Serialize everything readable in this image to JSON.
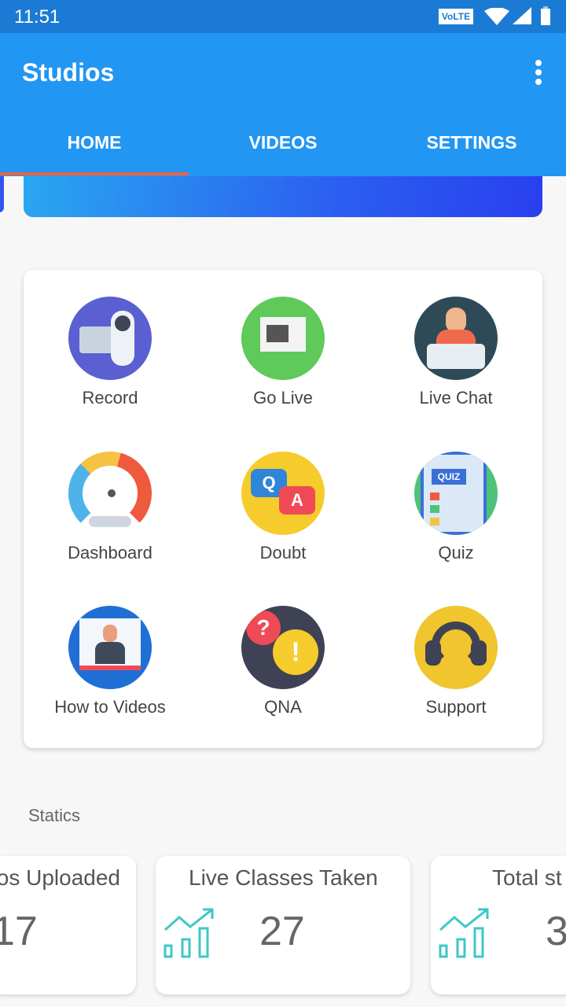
{
  "status": {
    "time": "11:51",
    "volte": "VoLTE"
  },
  "appbar": {
    "title": "Studios"
  },
  "tabs": [
    {
      "label": "HOME",
      "active": true
    },
    {
      "label": "VIDEOS"
    },
    {
      "label": "SETTINGS"
    }
  ],
  "colors": {
    "primary": "#2196f3",
    "status_bar": "#1b7bd4",
    "tab_indicator": "#e8634a",
    "trend_icon": "#3ec7c7"
  },
  "grid": [
    {
      "label": "Record",
      "icon": "video-camera-icon"
    },
    {
      "label": "Go Live",
      "icon": "live-video-icon"
    },
    {
      "label": "Live Chat",
      "icon": "live-chat-icon"
    },
    {
      "label": "Dashboard",
      "icon": "speedometer-icon"
    },
    {
      "label": "Doubt",
      "icon": "qa-bubbles-icon"
    },
    {
      "label": "Quiz",
      "icon": "quiz-icon"
    },
    {
      "label": "How to Videos",
      "icon": "tutorial-video-icon"
    },
    {
      "label": "QNA",
      "icon": "question-exclamation-icon"
    },
    {
      "label": "Support",
      "icon": "headset-icon"
    }
  ],
  "statics": {
    "title": "Statics",
    "cards": [
      {
        "label": "os Uploaded",
        "value": "17"
      },
      {
        "label": "Live Classes Taken",
        "value": "27"
      },
      {
        "label": "Total st",
        "value": "3"
      }
    ]
  }
}
